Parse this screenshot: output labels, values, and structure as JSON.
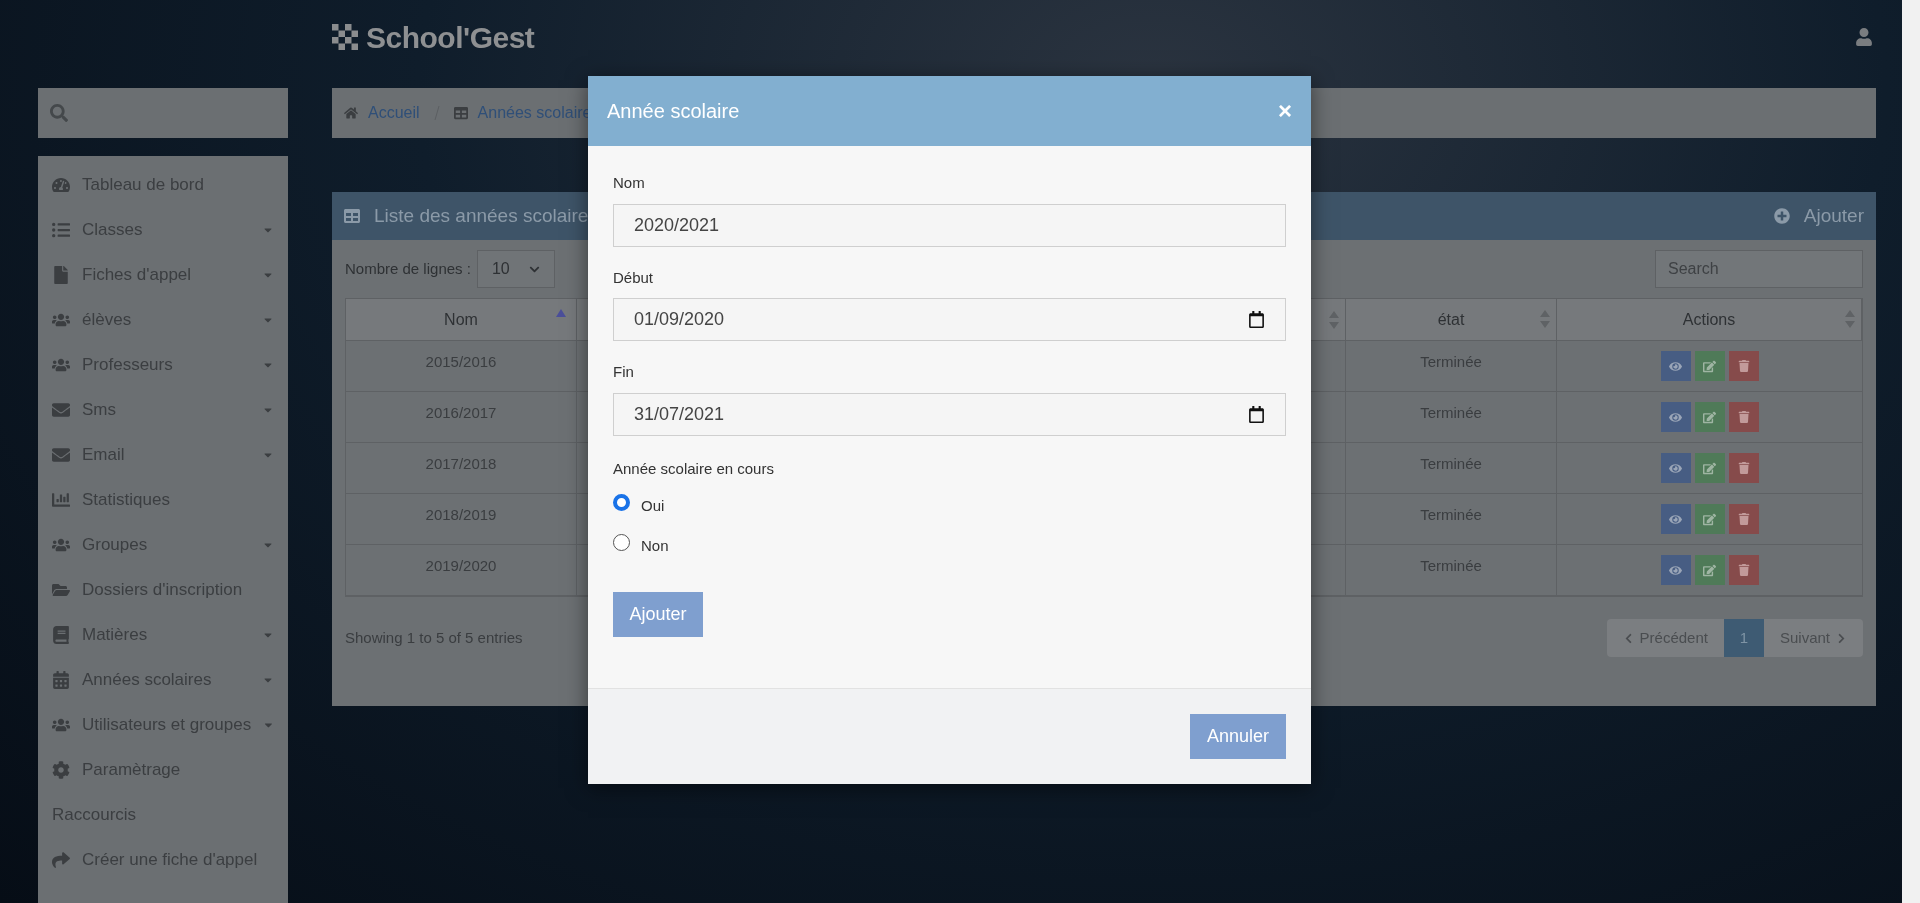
{
  "app": {
    "title": "School'Gest"
  },
  "sidebar": {
    "items": [
      {
        "label": "Tableau de bord",
        "kind": "link"
      },
      {
        "label": "Classes",
        "kind": "submenu"
      },
      {
        "label": "Fiches d'appel",
        "kind": "submenu"
      },
      {
        "label": "élèves",
        "kind": "submenu"
      },
      {
        "label": "Professeurs",
        "kind": "submenu"
      },
      {
        "label": "Sms",
        "kind": "submenu"
      },
      {
        "label": "Email",
        "kind": "submenu"
      },
      {
        "label": "Statistiques",
        "kind": "link"
      },
      {
        "label": "Groupes",
        "kind": "submenu"
      },
      {
        "label": "Dossiers d'inscription",
        "kind": "link"
      },
      {
        "label": "Matières",
        "kind": "submenu"
      },
      {
        "label": "Années scolaires",
        "kind": "submenu"
      },
      {
        "label": "Utilisateurs et groupes",
        "kind": "submenu"
      },
      {
        "label": "Paramètrage",
        "kind": "link"
      },
      {
        "label": "Raccourcis",
        "kind": "heading"
      },
      {
        "label": "Créer une fiche d'appel",
        "kind": "link"
      }
    ]
  },
  "breadcrumb": [
    "Accueil",
    "Années scolaire"
  ],
  "panel": {
    "title": "Liste des années scolaire",
    "add_button": "Ajouter",
    "rows_label": "Nombre de lignes :",
    "rows_value": "10",
    "search_placeholder": "Search",
    "columns": [
      {
        "label": "Nom",
        "sorted": true
      },
      {
        "label": "état",
        "sorted": false
      },
      {
        "label": "Actions",
        "sorted": false
      }
    ],
    "rows": [
      {
        "nom": "2015/2016",
        "etat": "Terminée"
      },
      {
        "nom": "2016/2017",
        "etat": "Terminée"
      },
      {
        "nom": "2017/2018",
        "etat": "Terminée"
      },
      {
        "nom": "2018/2019",
        "etat": "Terminée"
      },
      {
        "nom": "2019/2020",
        "etat": "Terminée"
      }
    ],
    "info": "Showing 1 to 5 of 5 entries",
    "pagination": {
      "previous": "Précédent",
      "pages": [
        {
          "label": "1",
          "selected": true
        }
      ],
      "next": "Suivant"
    }
  },
  "modal": {
    "title": "Année scolaire",
    "close": "×",
    "fields": [
      {
        "label": "Nom",
        "kind": "text",
        "value": "2020/2021"
      },
      {
        "label": "Début",
        "kind": "date",
        "value": "01/09/2020"
      },
      {
        "label": "Fin",
        "kind": "date",
        "value": "31/07/2021"
      }
    ],
    "radio_label": "Année scolaire en cours",
    "options": [
      {
        "label": "Oui",
        "selected": true
      },
      {
        "label": "Non",
        "selected": false
      }
    ],
    "submit": "Ajouter",
    "cancel": "Annuler"
  }
}
